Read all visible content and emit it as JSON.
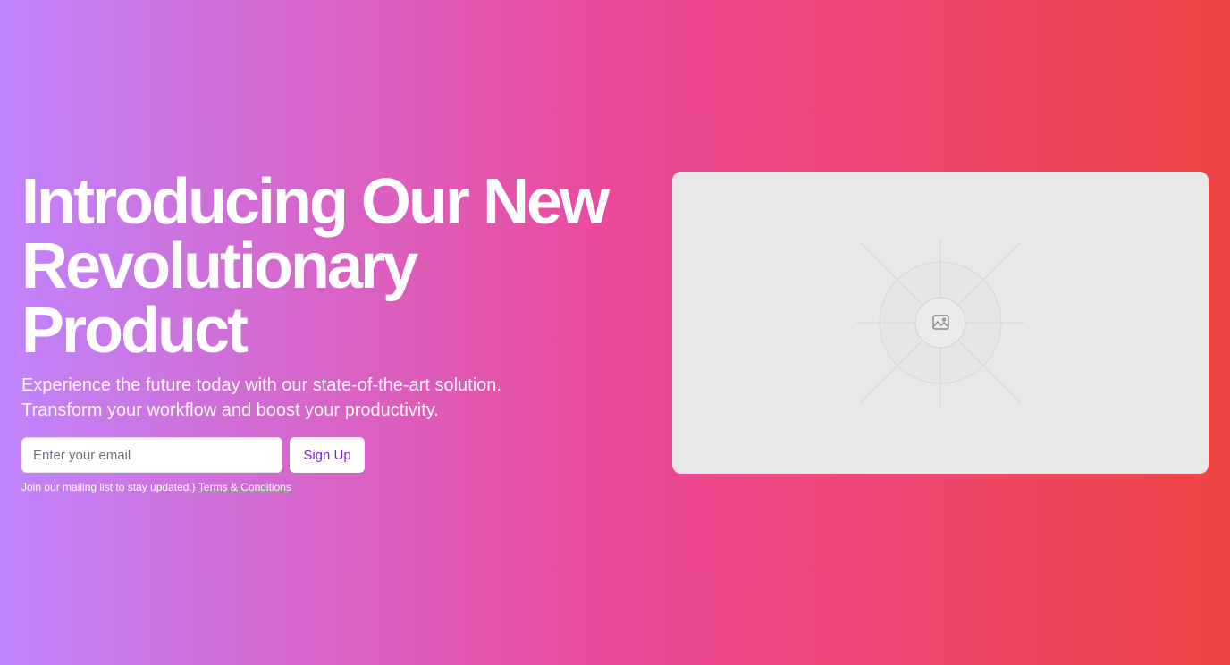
{
  "hero": {
    "title_lines": [
      "Introducing Our New",
      "Revolutionary",
      "Product"
    ],
    "subtitle_lines": [
      "Experience the future today with our state-of-the-art solution.",
      "Transform your workflow and boost your productivity."
    ]
  },
  "signup": {
    "email_placeholder": "Enter your email",
    "button_label": "Sign Up",
    "fineprint_text": "Join our mailing list to stay updated.}",
    "terms_label": "Terms & Conditions"
  },
  "media": {
    "icon": "image-placeholder-icon"
  },
  "colors": {
    "gradient_start": "#c084fc",
    "gradient_mid": "#ec4899",
    "gradient_end": "#ef4444",
    "button_text": "#7e22ce",
    "placeholder_bg": "#e8e8e8"
  }
}
